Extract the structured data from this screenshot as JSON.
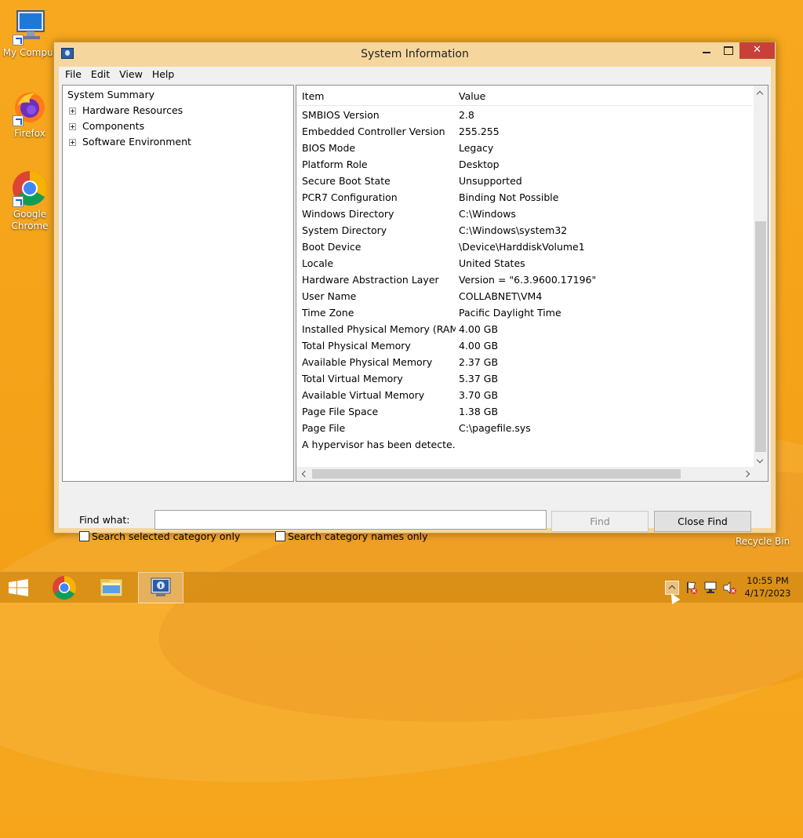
{
  "desktop": {
    "icons": [
      {
        "label": "My Comput",
        "icon": "computer-icon"
      },
      {
        "label": "Firefox",
        "icon": "firefox-icon"
      },
      {
        "label": "Google Chrome",
        "icon": "chrome-icon"
      }
    ],
    "recycle_bin_label": "Recycle Bin"
  },
  "window": {
    "title": "System Information",
    "menu": [
      "File",
      "Edit",
      "View",
      "Help"
    ],
    "tree": [
      {
        "label": "System Summary",
        "expandable": false
      },
      {
        "label": "Hardware Resources",
        "expandable": true
      },
      {
        "label": "Components",
        "expandable": true
      },
      {
        "label": "Software Environment",
        "expandable": true
      }
    ],
    "list": {
      "columns": [
        "Item",
        "Value"
      ],
      "rows": [
        [
          "SMBIOS Version",
          "2.8"
        ],
        [
          "Embedded Controller Version",
          "255.255"
        ],
        [
          "BIOS Mode",
          "Legacy"
        ],
        [
          "Platform Role",
          "Desktop"
        ],
        [
          "Secure Boot State",
          "Unsupported"
        ],
        [
          "PCR7 Configuration",
          "Binding Not Possible"
        ],
        [
          "Windows Directory",
          "C:\\Windows"
        ],
        [
          "System Directory",
          "C:\\Windows\\system32"
        ],
        [
          "Boot Device",
          "\\Device\\HarddiskVolume1"
        ],
        [
          "Locale",
          "United States"
        ],
        [
          "Hardware Abstraction Layer",
          "Version = \"6.3.9600.17196\""
        ],
        [
          "User Name",
          "COLLABNET\\VM4"
        ],
        [
          "Time Zone",
          "Pacific Daylight Time"
        ],
        [
          "Installed Physical Memory (RAM)",
          "4.00 GB"
        ],
        [
          "Total Physical Memory",
          "4.00 GB"
        ],
        [
          "Available Physical Memory",
          "2.37 GB"
        ],
        [
          "Total Virtual Memory",
          "5.37 GB"
        ],
        [
          "Available Virtual Memory",
          "3.70 GB"
        ],
        [
          "Page File Space",
          "1.38 GB"
        ],
        [
          "Page File",
          "C:\\pagefile.sys"
        ],
        [
          "A hypervisor has been detecte...",
          ""
        ]
      ]
    },
    "find": {
      "label": "Find what:",
      "value": "",
      "find_button": "Find",
      "close_find_button": "Close Find",
      "search_selected_label": "Search selected category only",
      "search_names_label": "Search category names only"
    }
  },
  "taskbar": {
    "items": [
      "start-icon",
      "chrome-icon",
      "file-explorer-icon",
      "system-information-icon"
    ],
    "tray_icons": [
      "show-hidden-icons-icon",
      "action-center-flag-icon",
      "network-icon",
      "volume-muted-icon"
    ],
    "time": "10:55 PM",
    "date": "4/17/2023"
  },
  "colors": {
    "wallpaper": "#f5a41a",
    "close_button": "#c7413a",
    "window_frame": "#f5d69c"
  }
}
